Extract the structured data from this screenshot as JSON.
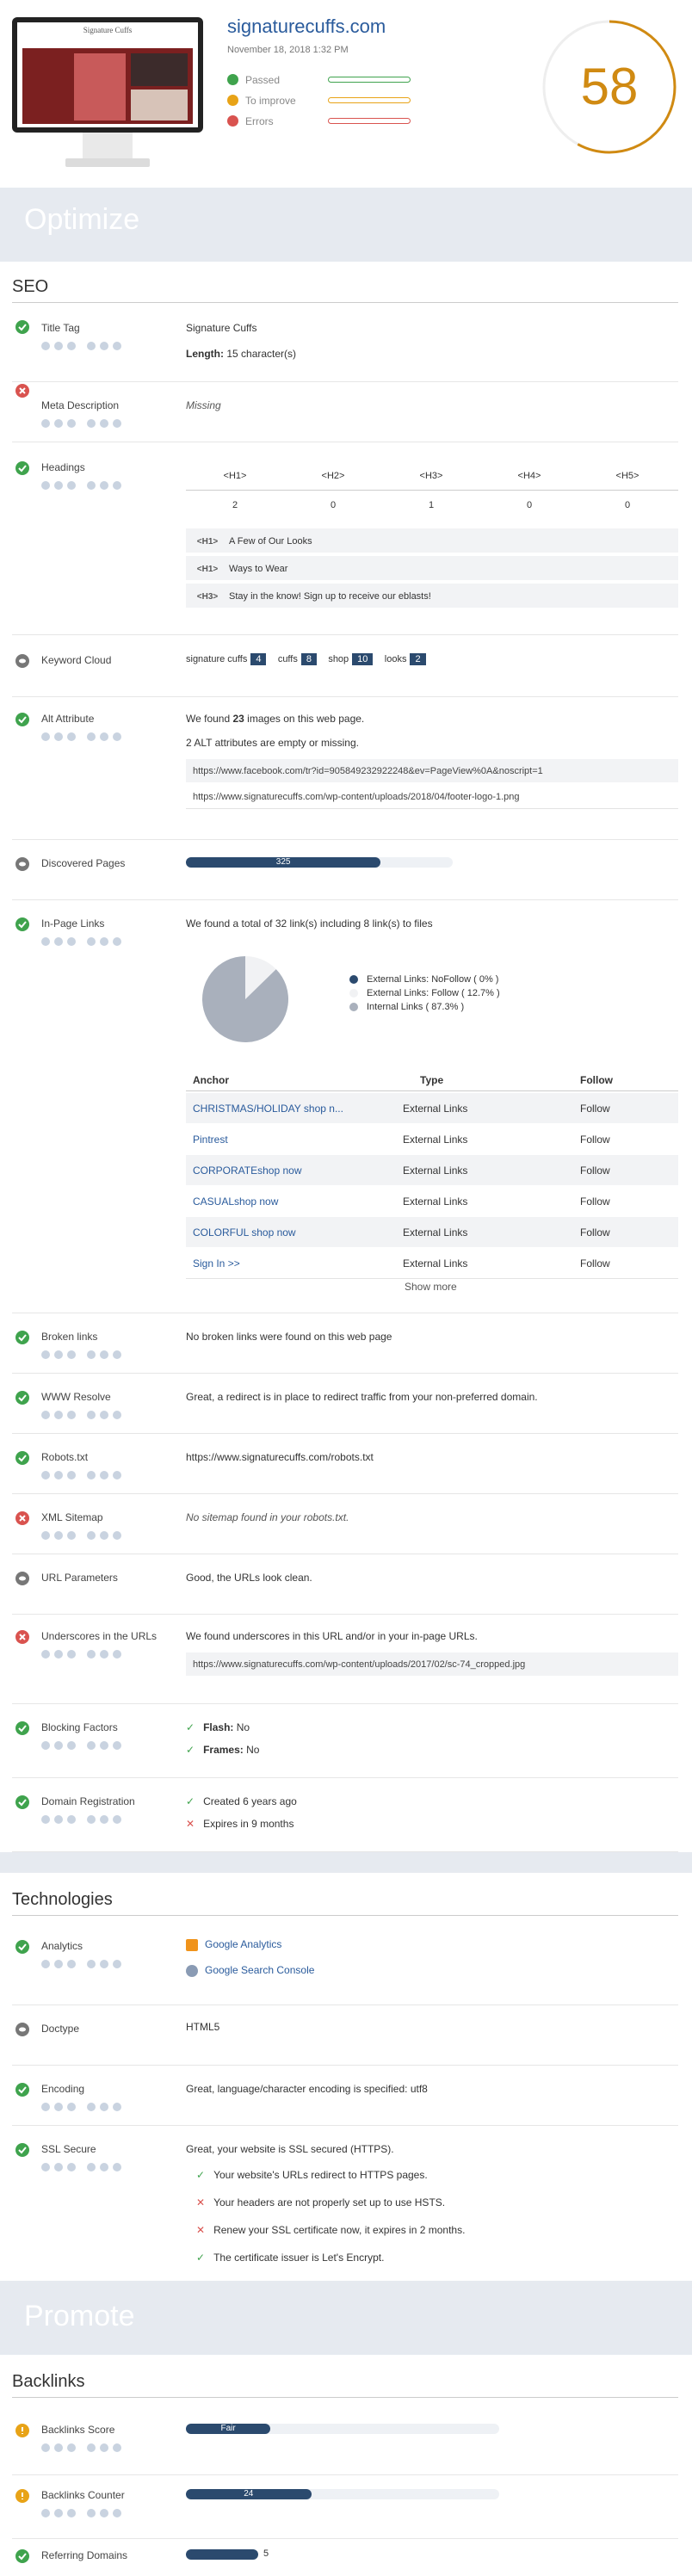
{
  "header": {
    "site": "signaturecuffs.com",
    "date": "November 18, 2018 1:32 PM",
    "legend": [
      {
        "label": "Passed",
        "color": "#3fa34d"
      },
      {
        "label": "To improve",
        "color": "#e8a317"
      },
      {
        "label": "Errors",
        "color": "#d9534f"
      }
    ],
    "score": "58",
    "score_fraction": 0.58,
    "thumb_logo": "Signature Cuffs"
  },
  "sections": {
    "optimize": "Optimize",
    "seo": "SEO",
    "technologies": "Technologies",
    "promote": "Promote",
    "backlinks": "Backlinks"
  },
  "seo": {
    "title_tag": {
      "label": "Title Tag",
      "value": "Signature Cuffs",
      "length_label": "Length:",
      "length_value": "15 character(s)"
    },
    "meta_description": {
      "label": "Meta Description",
      "value": "Missing"
    },
    "headings": {
      "label": "Headings",
      "cols": [
        "<H1>",
        "<H2>",
        "<H3>",
        "<H4>",
        "<H5>"
      ],
      "counts": [
        "2",
        "0",
        "1",
        "0",
        "0"
      ],
      "items": [
        {
          "tag": "<H1>",
          "text": "A Few of Our Looks"
        },
        {
          "tag": "<H1>",
          "text": "Ways to Wear"
        },
        {
          "tag": "<H3>",
          "text": "Stay in the know! Sign up to receive our eblasts!"
        }
      ]
    },
    "keyword_cloud": {
      "label": "Keyword Cloud",
      "items": [
        {
          "word": "signature cuffs",
          "count": "4"
        },
        {
          "word": "cuffs",
          "count": "8"
        },
        {
          "word": "shop",
          "count": "10"
        },
        {
          "word": "looks",
          "count": "2"
        }
      ]
    },
    "alt_attribute": {
      "label": "Alt Attribute",
      "line1_pre": "We found ",
      "line1_num": "23",
      "line1_post": " images on this web page.",
      "line2": "2 ALT attributes are empty or missing.",
      "urls": [
        "https://www.facebook.com/tr?id=905849232922248&ev=PageView%0A&noscript=1",
        "https://www.signaturecuffs.com/wp-content/uploads/2018/04/footer-logo-1.png"
      ]
    },
    "discovered_pages": {
      "label": "Discovered Pages",
      "value": "325",
      "fraction": 0.73
    },
    "in_page_links": {
      "label": "In-Page Links",
      "summary": "We found a total of 32 link(s) including 8 link(s) to files",
      "pie": [
        {
          "label": "External Links: NoFollow ( 0% )",
          "value": 0,
          "color": "#2b4a6e"
        },
        {
          "label": "External Links: Follow ( 12.7% )",
          "value": 12.7,
          "color": "#f1f2f4"
        },
        {
          "label": "Internal Links ( 87.3% )",
          "value": 87.3,
          "color": "#a9b0bc"
        }
      ],
      "columns": [
        "Anchor",
        "Type",
        "Follow"
      ],
      "rows": [
        [
          "CHRISTMAS/HOLIDAY shop n...",
          "External Links",
          "Follow"
        ],
        [
          "Pintrest",
          "External Links",
          "Follow"
        ],
        [
          "CORPORATEshop now",
          "External Links",
          "Follow"
        ],
        [
          "CASUALshop now",
          "External Links",
          "Follow"
        ],
        [
          "COLORFUL shop now",
          "External Links",
          "Follow"
        ],
        [
          "Sign In >>",
          "External Links",
          "Follow"
        ]
      ],
      "show_more": "Show more"
    },
    "broken_links": {
      "label": "Broken links",
      "value": "No broken links were found on this web page"
    },
    "www_resolve": {
      "label": "WWW Resolve",
      "value": "Great, a redirect is in place to redirect traffic from your non-preferred domain."
    },
    "robots": {
      "label": "Robots.txt",
      "value": "https://www.signaturecuffs.com/robots.txt"
    },
    "xml_sitemap": {
      "label": "XML Sitemap",
      "value": "No sitemap found in your robots.txt."
    },
    "url_parameters": {
      "label": "URL Parameters",
      "value": "Good, the URLs look clean."
    },
    "underscores": {
      "label": "Underscores in the URLs",
      "value": "We found underscores in this URL and/or in your in-page URLs.",
      "url": "https://www.signaturecuffs.com/wp-content/uploads/2017/02/sc-74_cropped.jpg"
    },
    "blocking": {
      "label": "Blocking Factors",
      "items": [
        {
          "k": "Flash:",
          "v": "No"
        },
        {
          "k": "Frames:",
          "v": "No"
        }
      ]
    },
    "domain_registration": {
      "label": "Domain Registration",
      "items": [
        {
          "text": "Created 6 years ago",
          "ok": true
        },
        {
          "text": "Expires in 9 months",
          "ok": false
        }
      ]
    }
  },
  "tech": {
    "analytics": {
      "label": "Analytics",
      "items": [
        "Google Analytics",
        "Google Search Console"
      ]
    },
    "doctype": {
      "label": "Doctype",
      "value": "HTML5"
    },
    "encoding": {
      "label": "Encoding",
      "value": "Great, language/character encoding is specified: utf8"
    },
    "ssl": {
      "label": "SSL Secure",
      "value": "Great, your website is SSL secured (HTTPS).",
      "items": [
        {
          "text": "Your website's URLs redirect to HTTPS pages.",
          "ok": true
        },
        {
          "text": "Your headers are not properly set up to use HSTS.",
          "ok": false
        },
        {
          "text": "Renew your SSL certificate now, it expires in 2 months.",
          "ok": false
        },
        {
          "text": "The certificate issuer is Let's Encrypt.",
          "ok": true
        }
      ]
    }
  },
  "backlinks": {
    "score": {
      "label": "Backlinks Score",
      "value": "Fair",
      "fraction": 0.27
    },
    "counter": {
      "label": "Backlinks Counter",
      "value": "24",
      "fraction": 0.4
    },
    "domains": {
      "label": "Referring Domains",
      "value": "5",
      "fraction": 0.23
    }
  }
}
